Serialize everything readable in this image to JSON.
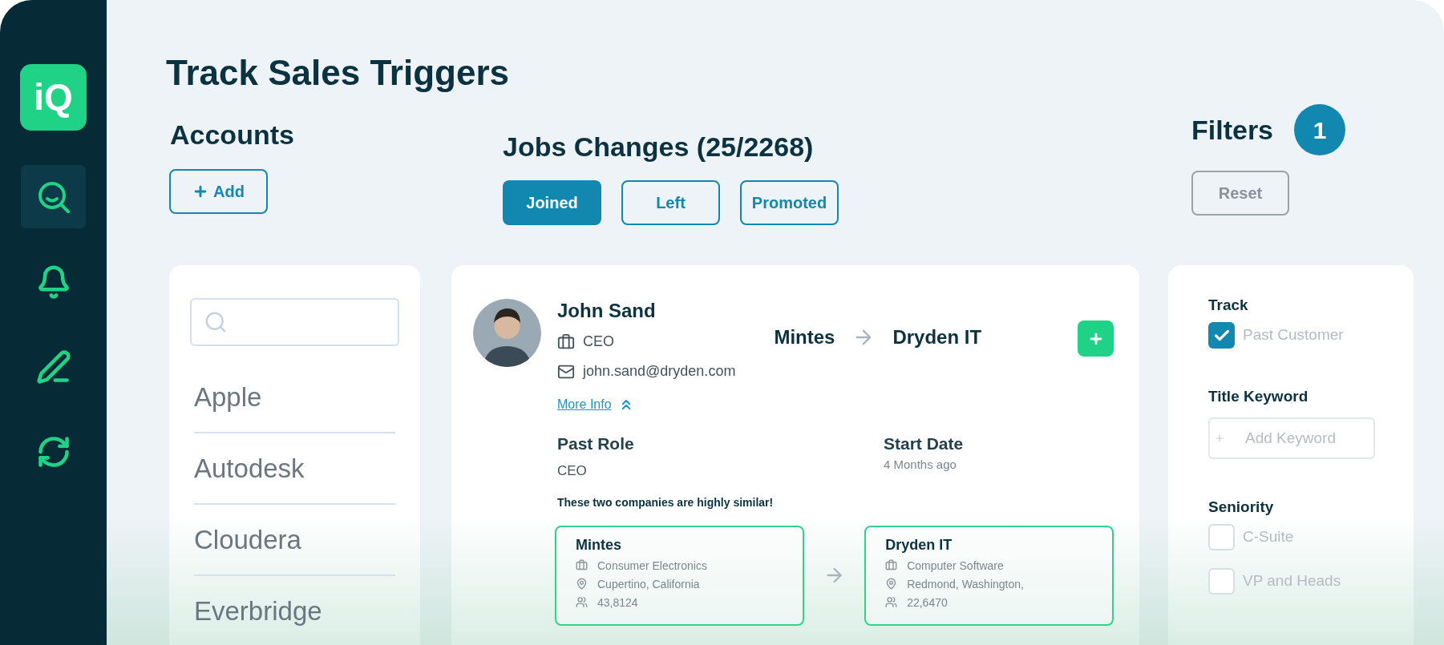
{
  "sidebar": {
    "logo": "iQ",
    "items": [
      {
        "kind": "search",
        "selected": true
      },
      {
        "kind": "bell",
        "selected": false
      },
      {
        "kind": "pencil",
        "selected": false
      },
      {
        "kind": "refresh",
        "selected": false
      }
    ]
  },
  "title": "Track Sales Triggers",
  "accounts": {
    "heading": "Accounts",
    "add_button": "Add",
    "items": [
      "Apple",
      "Autodesk",
      "Cloudera",
      "Everbridge"
    ]
  },
  "job_changes": {
    "heading": "Jobs Changes (25/2268)",
    "tabs": [
      {
        "label": "Joined",
        "selected": true
      },
      {
        "label": "Left",
        "selected": false
      },
      {
        "label": "Promoted",
        "selected": false
      }
    ],
    "card": {
      "name": "John Sand",
      "role": "CEO",
      "email": "john.sand@dryden.com",
      "from_company": "Mintes",
      "to_company": "Dryden IT",
      "more_info": "More Info",
      "details": [
        {
          "label": "Past Role",
          "value": "CEO",
          "kind": "large"
        },
        {
          "label": "Start Date",
          "value": "4 Months ago",
          "kind": "small"
        }
      ],
      "similarity_note": "These two companies are highly similar!",
      "companies": [
        {
          "name": "Mintes",
          "industry": "Consumer Electronics",
          "location": "Cupertino, California",
          "employees": "43,8124"
        },
        {
          "name": "Dryden IT",
          "industry": "Computer Software",
          "location": "Redmond, Washington,",
          "employees": "22,6470"
        }
      ]
    }
  },
  "filters": {
    "heading": "Filters",
    "badge": "1",
    "reset_button": "Reset",
    "sections": [
      {
        "title": "Track",
        "kind": "checkboxes",
        "options": [
          {
            "label": "Past Customer",
            "checked": true
          }
        ]
      },
      {
        "title": "Title Keyword",
        "kind": "keyword",
        "placeholder": "Add Keyword"
      },
      {
        "title": "Seniority",
        "kind": "checkboxes",
        "options": [
          {
            "label": "C-Suite",
            "checked": false
          },
          {
            "label": "VP and Heads",
            "checked": false
          }
        ]
      }
    ]
  }
}
